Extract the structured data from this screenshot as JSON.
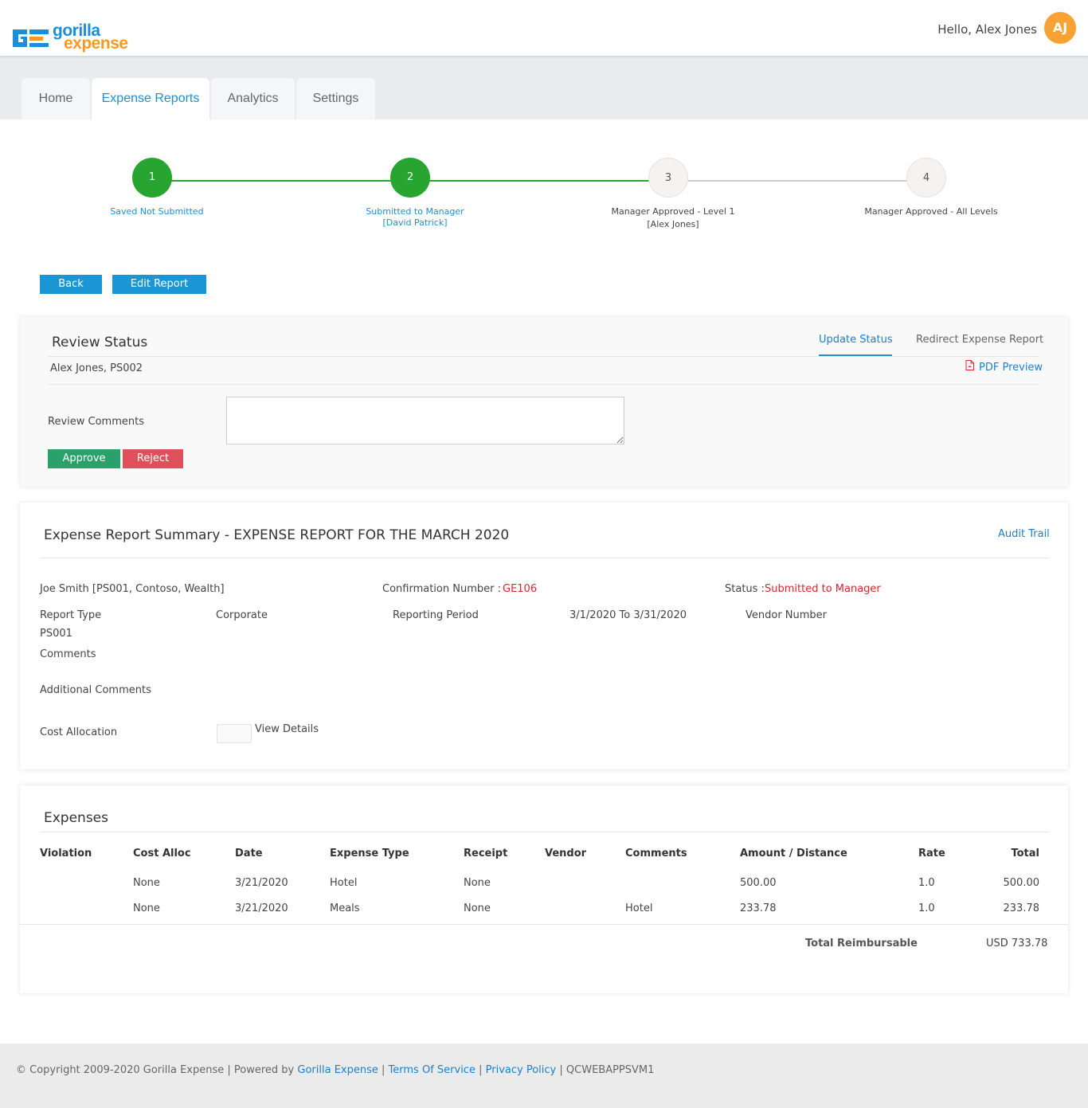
{
  "header": {
    "logo_line1": "gorilla",
    "logo_line2": "expense",
    "greeting": "Hello, Alex Jones",
    "avatar_initials": "AJ"
  },
  "tabs": [
    {
      "label": "Home",
      "active": false
    },
    {
      "label": "Expense Reports",
      "active": true
    },
    {
      "label": "Analytics",
      "active": false
    },
    {
      "label": "Settings",
      "active": false
    }
  ],
  "stepper": {
    "steps": [
      {
        "number": "1",
        "label": "Saved Not Submitted",
        "sublabel": "",
        "done": true
      },
      {
        "number": "2",
        "label": "Submitted to Manager",
        "sublabel": "[David Patrick]",
        "done": true
      },
      {
        "number": "3",
        "label": "Manager Approved - Level 1",
        "sublabel": "[Alex Jones]",
        "done": false
      },
      {
        "number": "4",
        "label": "Manager Approved - All Levels",
        "sublabel": "",
        "done": false
      }
    ]
  },
  "actions": {
    "back_label": "Back",
    "edit_label": "Edit Report"
  },
  "review": {
    "title": "Review Status",
    "update_status_label": "Update Status",
    "redirect_label": "Redirect Expense Report",
    "employee": "Alex Jones, PS002",
    "pdf_preview_label": "PDF Preview",
    "comments_label": "Review Comments",
    "comments_value": "",
    "approve_label": "Approve",
    "reject_label": "Reject"
  },
  "summary": {
    "title": "Expense Report Summary - EXPENSE REPORT FOR THE MARCH 2020",
    "audit_trail_label": "Audit Trail",
    "employee": "Joe Smith [PS001, Contoso, Wealth]",
    "confirmation_label": "Confirmation Number :",
    "confirmation_value": "GE106",
    "status_label": "Status :",
    "status_value": "Submitted to Manager",
    "report_type_label": "Report Type",
    "report_type_value": "Corporate",
    "reporting_period_label": "Reporting Period",
    "reporting_period_value": "3/1/2020 To 3/31/2020",
    "vendor_number_label": "Vendor Number",
    "code": "PS001",
    "comments_label": "Comments",
    "additional_comments_label": "Additional Comments",
    "cost_allocation_label": "Cost Allocation",
    "view_details_label": "View Details"
  },
  "expenses": {
    "title": "Expenses",
    "columns": [
      "Violation",
      "Cost Alloc",
      "Date",
      "Expense Type",
      "Receipt",
      "Vendor",
      "Comments",
      "Amount / Distance",
      "Rate",
      "Total"
    ],
    "rows": [
      {
        "violation": "",
        "cost_alloc": "None",
        "date": "3/21/2020",
        "type": "Hotel",
        "receipt": "None",
        "vendor": "",
        "comments": "",
        "amount": "500.00",
        "rate": "1.0",
        "total": "500.00"
      },
      {
        "violation": "",
        "cost_alloc": "None",
        "date": "3/21/2020",
        "type": "Meals",
        "receipt": "None",
        "vendor": "",
        "comments": "Hotel",
        "amount": "233.78",
        "rate": "1.0",
        "total": "233.78"
      }
    ],
    "total_label": "Total Reimbursable",
    "total_value": "USD 733.78"
  },
  "footer": {
    "copyright": "© Copyright 2009-2020 Gorilla Expense | Powered by",
    "powered_by": "Gorilla Expense",
    "sep1": "|",
    "terms": "Terms Of Service",
    "sep2": "|",
    "privacy": "Privacy Policy",
    "sep3": "|",
    "server": "QCWEBAPPSVM1"
  },
  "colors": {
    "accent_blue": "#1b96d4",
    "step_done_green": "#27a530",
    "approve_green": "#2aa06b",
    "reject_red": "#e0505c",
    "avatar_orange": "#f7a232",
    "alert_red": "#d9262e"
  }
}
